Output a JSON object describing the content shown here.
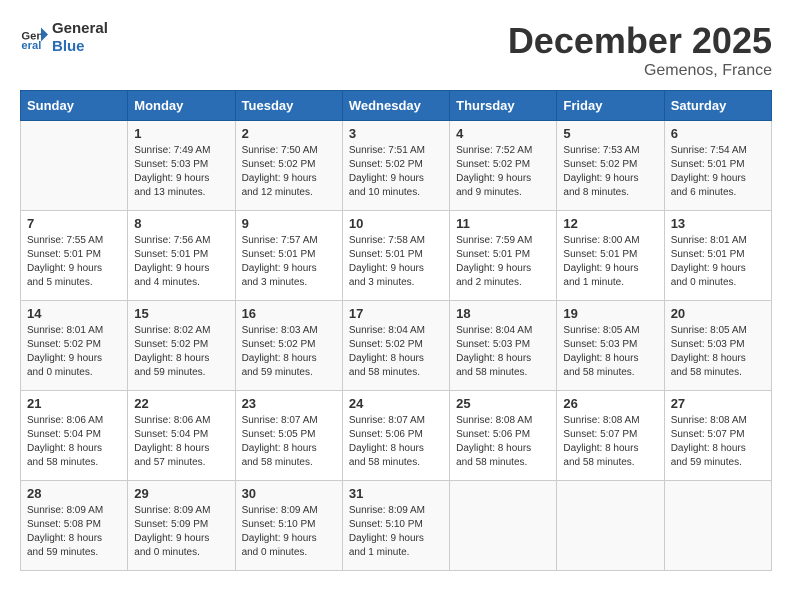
{
  "header": {
    "logo_line1": "General",
    "logo_line2": "Blue",
    "month": "December 2025",
    "location": "Gemenos, France"
  },
  "days_of_week": [
    "Sunday",
    "Monday",
    "Tuesday",
    "Wednesday",
    "Thursday",
    "Friday",
    "Saturday"
  ],
  "weeks": [
    [
      {
        "day": "",
        "sunrise": "",
        "sunset": "",
        "daylight": ""
      },
      {
        "day": "1",
        "sunrise": "Sunrise: 7:49 AM",
        "sunset": "Sunset: 5:03 PM",
        "daylight": "Daylight: 9 hours and 13 minutes."
      },
      {
        "day": "2",
        "sunrise": "Sunrise: 7:50 AM",
        "sunset": "Sunset: 5:02 PM",
        "daylight": "Daylight: 9 hours and 12 minutes."
      },
      {
        "day": "3",
        "sunrise": "Sunrise: 7:51 AM",
        "sunset": "Sunset: 5:02 PM",
        "daylight": "Daylight: 9 hours and 10 minutes."
      },
      {
        "day": "4",
        "sunrise": "Sunrise: 7:52 AM",
        "sunset": "Sunset: 5:02 PM",
        "daylight": "Daylight: 9 hours and 9 minutes."
      },
      {
        "day": "5",
        "sunrise": "Sunrise: 7:53 AM",
        "sunset": "Sunset: 5:02 PM",
        "daylight": "Daylight: 9 hours and 8 minutes."
      },
      {
        "day": "6",
        "sunrise": "Sunrise: 7:54 AM",
        "sunset": "Sunset: 5:01 PM",
        "daylight": "Daylight: 9 hours and 6 minutes."
      }
    ],
    [
      {
        "day": "7",
        "sunrise": "Sunrise: 7:55 AM",
        "sunset": "Sunset: 5:01 PM",
        "daylight": "Daylight: 9 hours and 5 minutes."
      },
      {
        "day": "8",
        "sunrise": "Sunrise: 7:56 AM",
        "sunset": "Sunset: 5:01 PM",
        "daylight": "Daylight: 9 hours and 4 minutes."
      },
      {
        "day": "9",
        "sunrise": "Sunrise: 7:57 AM",
        "sunset": "Sunset: 5:01 PM",
        "daylight": "Daylight: 9 hours and 3 minutes."
      },
      {
        "day": "10",
        "sunrise": "Sunrise: 7:58 AM",
        "sunset": "Sunset: 5:01 PM",
        "daylight": "Daylight: 9 hours and 3 minutes."
      },
      {
        "day": "11",
        "sunrise": "Sunrise: 7:59 AM",
        "sunset": "Sunset: 5:01 PM",
        "daylight": "Daylight: 9 hours and 2 minutes."
      },
      {
        "day": "12",
        "sunrise": "Sunrise: 8:00 AM",
        "sunset": "Sunset: 5:01 PM",
        "daylight": "Daylight: 9 hours and 1 minute."
      },
      {
        "day": "13",
        "sunrise": "Sunrise: 8:01 AM",
        "sunset": "Sunset: 5:01 PM",
        "daylight": "Daylight: 9 hours and 0 minutes."
      }
    ],
    [
      {
        "day": "14",
        "sunrise": "Sunrise: 8:01 AM",
        "sunset": "Sunset: 5:02 PM",
        "daylight": "Daylight: 9 hours and 0 minutes."
      },
      {
        "day": "15",
        "sunrise": "Sunrise: 8:02 AM",
        "sunset": "Sunset: 5:02 PM",
        "daylight": "Daylight: 8 hours and 59 minutes."
      },
      {
        "day": "16",
        "sunrise": "Sunrise: 8:03 AM",
        "sunset": "Sunset: 5:02 PM",
        "daylight": "Daylight: 8 hours and 59 minutes."
      },
      {
        "day": "17",
        "sunrise": "Sunrise: 8:04 AM",
        "sunset": "Sunset: 5:02 PM",
        "daylight": "Daylight: 8 hours and 58 minutes."
      },
      {
        "day": "18",
        "sunrise": "Sunrise: 8:04 AM",
        "sunset": "Sunset: 5:03 PM",
        "daylight": "Daylight: 8 hours and 58 minutes."
      },
      {
        "day": "19",
        "sunrise": "Sunrise: 8:05 AM",
        "sunset": "Sunset: 5:03 PM",
        "daylight": "Daylight: 8 hours and 58 minutes."
      },
      {
        "day": "20",
        "sunrise": "Sunrise: 8:05 AM",
        "sunset": "Sunset: 5:03 PM",
        "daylight": "Daylight: 8 hours and 58 minutes."
      }
    ],
    [
      {
        "day": "21",
        "sunrise": "Sunrise: 8:06 AM",
        "sunset": "Sunset: 5:04 PM",
        "daylight": "Daylight: 8 hours and 58 minutes."
      },
      {
        "day": "22",
        "sunrise": "Sunrise: 8:06 AM",
        "sunset": "Sunset: 5:04 PM",
        "daylight": "Daylight: 8 hours and 57 minutes."
      },
      {
        "day": "23",
        "sunrise": "Sunrise: 8:07 AM",
        "sunset": "Sunset: 5:05 PM",
        "daylight": "Daylight: 8 hours and 58 minutes."
      },
      {
        "day": "24",
        "sunrise": "Sunrise: 8:07 AM",
        "sunset": "Sunset: 5:06 PM",
        "daylight": "Daylight: 8 hours and 58 minutes."
      },
      {
        "day": "25",
        "sunrise": "Sunrise: 8:08 AM",
        "sunset": "Sunset: 5:06 PM",
        "daylight": "Daylight: 8 hours and 58 minutes."
      },
      {
        "day": "26",
        "sunrise": "Sunrise: 8:08 AM",
        "sunset": "Sunset: 5:07 PM",
        "daylight": "Daylight: 8 hours and 58 minutes."
      },
      {
        "day": "27",
        "sunrise": "Sunrise: 8:08 AM",
        "sunset": "Sunset: 5:07 PM",
        "daylight": "Daylight: 8 hours and 59 minutes."
      }
    ],
    [
      {
        "day": "28",
        "sunrise": "Sunrise: 8:09 AM",
        "sunset": "Sunset: 5:08 PM",
        "daylight": "Daylight: 8 hours and 59 minutes."
      },
      {
        "day": "29",
        "sunrise": "Sunrise: 8:09 AM",
        "sunset": "Sunset: 5:09 PM",
        "daylight": "Daylight: 9 hours and 0 minutes."
      },
      {
        "day": "30",
        "sunrise": "Sunrise: 8:09 AM",
        "sunset": "Sunset: 5:10 PM",
        "daylight": "Daylight: 9 hours and 0 minutes."
      },
      {
        "day": "31",
        "sunrise": "Sunrise: 8:09 AM",
        "sunset": "Sunset: 5:10 PM",
        "daylight": "Daylight: 9 hours and 1 minute."
      },
      {
        "day": "",
        "sunrise": "",
        "sunset": "",
        "daylight": ""
      },
      {
        "day": "",
        "sunrise": "",
        "sunset": "",
        "daylight": ""
      },
      {
        "day": "",
        "sunrise": "",
        "sunset": "",
        "daylight": ""
      }
    ]
  ]
}
